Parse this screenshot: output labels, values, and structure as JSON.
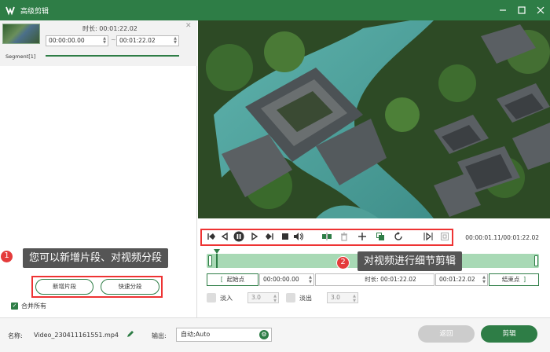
{
  "window": {
    "title": "高级剪辑"
  },
  "segment": {
    "duration_label": "时长: 00:01:22.02",
    "start": "00:00:00.00",
    "tilde": "~",
    "end": "00:01:22.02",
    "name": "Segment[1]"
  },
  "callouts": {
    "one": {
      "num": "1",
      "text": "您可以新增片段、对视频分段"
    },
    "two": {
      "num": "2",
      "text": "对视频进行细节剪辑"
    }
  },
  "left_buttons": {
    "add_segment": "新增片段",
    "fast_split": "快速分段"
  },
  "merge_all": "合并所有",
  "player": {
    "current_time": "00:00:01.11/00:01:22.02"
  },
  "trim": {
    "start_btn": "起始点",
    "start_time": "00:00:00.00",
    "duration": "时长: 00:01:22.02",
    "end_time": "00:01:22.02",
    "end_btn": "结束点"
  },
  "fade": {
    "in_label": "淡入",
    "in_value": "3.0",
    "out_label": "淡出",
    "out_value": "3.0"
  },
  "bottom": {
    "name_label": "名称:",
    "name_value": "Video_230411161551.mp4",
    "output_label": "输出:",
    "output_value": "自动;Auto",
    "back": "返回",
    "export": "剪辑"
  },
  "colors": {
    "brand": "#2e7d46",
    "callout_bg": "#555555",
    "highlight": "#e33333"
  }
}
